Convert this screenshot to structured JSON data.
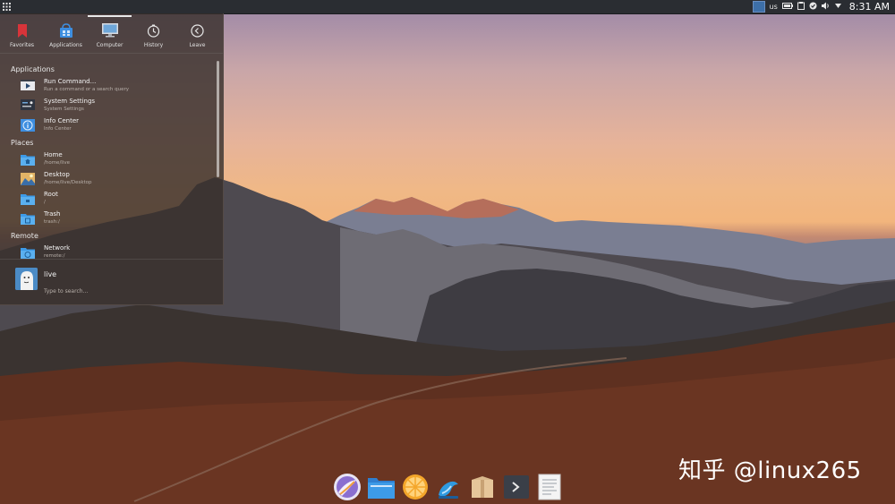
{
  "top_panel": {
    "keyboard_layout": "us",
    "clock": "8:31 AM"
  },
  "menu": {
    "tabs": [
      {
        "label": "Favorites",
        "icon": "bookmark-icon"
      },
      {
        "label": "Applications",
        "icon": "applications-icon"
      },
      {
        "label": "Computer",
        "icon": "computer-icon"
      },
      {
        "label": "History",
        "icon": "history-icon"
      },
      {
        "label": "Leave",
        "icon": "leave-icon"
      }
    ],
    "active_tab": "Computer",
    "sections": {
      "applications": {
        "title": "Applications",
        "items": [
          {
            "name": "Run Command...",
            "desc": "Run a command or a search query"
          },
          {
            "name": "System Settings",
            "desc": "System Settings"
          },
          {
            "name": "Info Center",
            "desc": "Info Center"
          }
        ]
      },
      "places": {
        "title": "Places",
        "items": [
          {
            "name": "Home",
            "desc": "/home/live"
          },
          {
            "name": "Desktop",
            "desc": "/home/live/Desktop"
          },
          {
            "name": "Root",
            "desc": "/"
          },
          {
            "name": "Trash",
            "desc": "trash:/"
          }
        ]
      },
      "remote": {
        "title": "Remote",
        "items": [
          {
            "name": "Network",
            "desc": "remote:/"
          }
        ]
      }
    },
    "footer": {
      "username": "live",
      "search_placeholder": "Type to search..."
    }
  },
  "dock": {
    "items": [
      "browser-icon",
      "file-manager-icon",
      "orange-app-icon",
      "store-icon",
      "package-icon",
      "terminal-icon",
      "text-editor-icon"
    ]
  },
  "watermark": "知乎 @linux265"
}
